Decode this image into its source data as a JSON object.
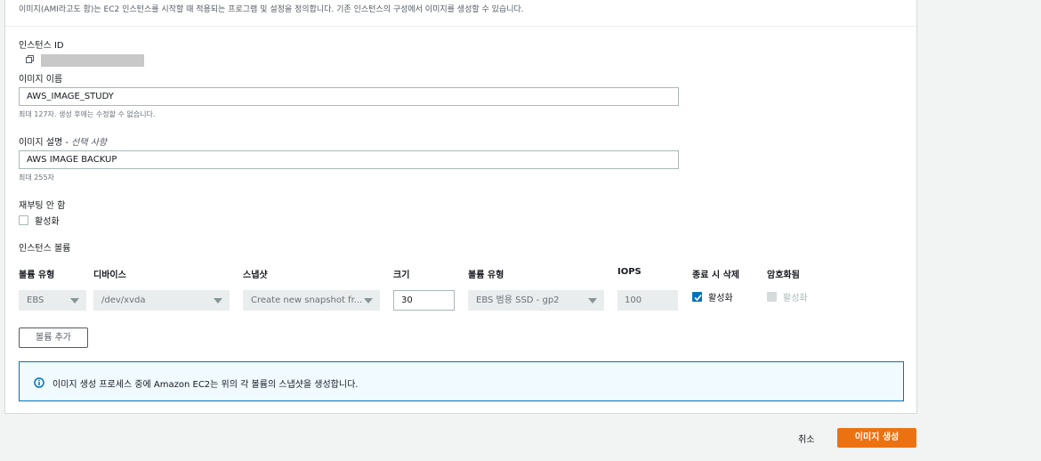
{
  "description": "이미지(AMI라고도 함)는 EC2 인스턴스를 시작할 때 적용되는 프로그램 및 설정을 정의합니다. 기존 인스턴스의 구성에서 이미지를 생성할 수 있습니다.",
  "instance_id": {
    "label": "인스턴스 ID"
  },
  "image_name": {
    "label": "이미지 이름",
    "value": "AWS_IMAGE_STUDY",
    "hint": "최대 127자. 생성 후에는 수정할 수 없습니다."
  },
  "image_description": {
    "label": "이미지 설명 - ",
    "optional": "선택 사항",
    "value": "AWS IMAGE BACKUP",
    "hint": "최대 255자"
  },
  "no_reboot": {
    "label": "재부팅 안 함",
    "checkbox_label": "활성화",
    "checked": false
  },
  "volumes": {
    "section_label": "인스턴스 볼륨",
    "columns": {
      "volume_type": "볼륨 유형",
      "device": "디바이스",
      "snapshot": "스냅샷",
      "size": "크기",
      "ebs_volume_type": "볼륨 유형",
      "iops": "IOPS",
      "delete_on_termination": "종료 시 삭제",
      "encrypted": "암호화됨"
    },
    "row": {
      "volume_type": "EBS",
      "device": "/dev/xvda",
      "snapshot": "Create new snapshot fr...",
      "size": "30",
      "ebs_volume_type": "EBS 범용 SSD - gp2",
      "iops": "100",
      "delete_on_termination_label": "활성화",
      "delete_on_termination": true,
      "encrypted_label": "활성화",
      "encrypted": false
    },
    "add_button": "볼륨 추가"
  },
  "info": {
    "text": "이미지 생성 프로세스 중에 Amazon EC2는 위의 각 볼륨의 스냅샷을 생성합니다."
  },
  "footer": {
    "cancel": "취소",
    "create": "이미지 생성"
  },
  "colors": {
    "primary": "#ec7211",
    "accent": "#0073bb",
    "info_bg": "#f1faff"
  }
}
